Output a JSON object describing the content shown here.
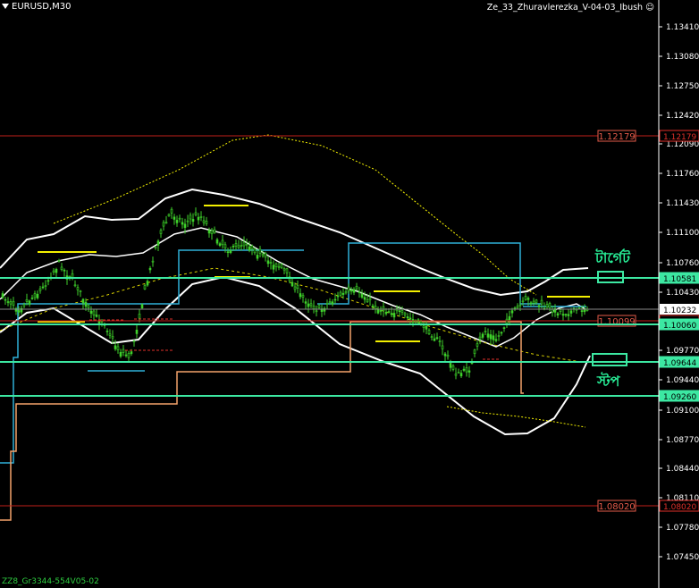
{
  "symbol": "EURUSD,M30",
  "expert": "Ze_33_Zhuravlerezka_V-04-03_Ibush",
  "footer": "ZZ8_Gr3344-554V05-02",
  "annotations": {
    "target": "টার্গেট",
    "stop": "স্টপ"
  },
  "colors": {
    "bg": "#000000",
    "grid_red": "#c0201a",
    "hline": "#3ce8a2",
    "candle": "#3fd12b",
    "yellow": "#f3f000",
    "blue": "#2fb0d8",
    "orange": "#f4a26a"
  },
  "price_scale": {
    "ticks": [
      "1.13410",
      "1.13080",
      "1.12750",
      "1.12420",
      "1.12090",
      "1.11760",
      "1.11430",
      "1.11100",
      "1.10760",
      "1.10430",
      "1.10100",
      "1.09770",
      "1.09440",
      "1.09100",
      "1.08770",
      "1.08440",
      "1.08110",
      "1.07780",
      "1.07450"
    ],
    "current": "1.10232"
  },
  "levels": [
    {
      "price": "1.12179",
      "style": "red",
      "label_color": "#e55b4a"
    },
    {
      "price": "1.10581",
      "style": "green",
      "label_color": "#3ce8a2"
    },
    {
      "price": "1.10099",
      "style": "red",
      "label_color": "#e55b4a"
    },
    {
      "price": "1.10060",
      "style": "green",
      "label_color": "#3ce8a2"
    },
    {
      "price": "1.09644",
      "style": "green",
      "label_color": "#3ce8a2"
    },
    {
      "price": "1.09260",
      "style": "green",
      "label_color": "#3ce8a2"
    },
    {
      "price": "1.08020",
      "style": "red",
      "label_color": "#e55b4a"
    }
  ]
}
